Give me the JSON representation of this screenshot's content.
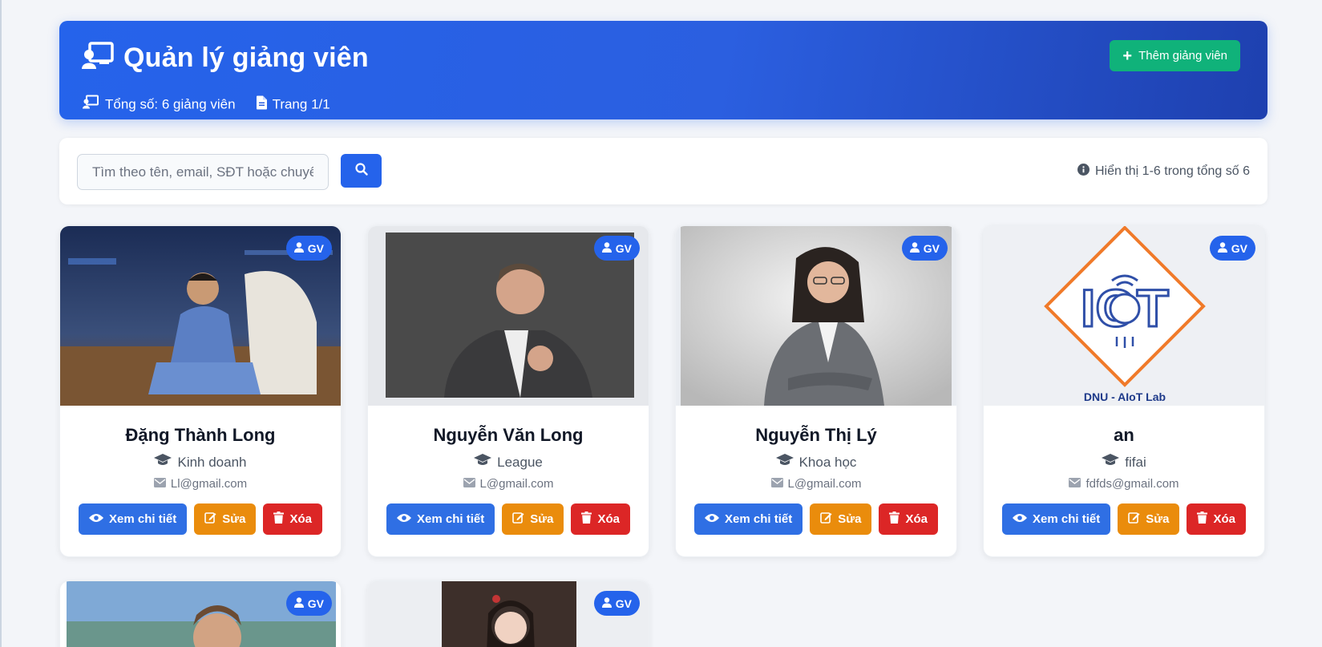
{
  "header": {
    "title": "Quản lý giảng viên",
    "total_label": "Tổng số: 6 giảng viên",
    "page_label": "Trang 1/1",
    "add_button_label": "Thêm giảng viên"
  },
  "search": {
    "placeholder": "Tìm theo tên, email, SĐT hoặc chuyên môn",
    "info": "Hiển thị 1-6 trong tổng số 6"
  },
  "colors": {
    "primary": "#2563eb",
    "success": "#10b27a",
    "warning": "#ea8c0c",
    "danger": "#dc2626"
  },
  "card_actions": {
    "view_label": "Xem chi tiết",
    "edit_label": "Sửa",
    "delete_label": "Xóa"
  },
  "lecturers": [
    {
      "badge": "GV",
      "name": "Đặng Thành Long",
      "department": "Kinh doanh",
      "email": "Ll@gmail.com"
    },
    {
      "badge": "GV",
      "name": "Nguyễn Văn Long",
      "department": "League",
      "email": "L@gmail.com"
    },
    {
      "badge": "GV",
      "name": "Nguyễn Thị Lý",
      "department": "Khoa học",
      "email": "L@gmail.com"
    },
    {
      "badge": "GV",
      "name": "an",
      "department": "fifai",
      "email": "fdfds@gmail.com",
      "logo_text": "DNU - AIoT Lab"
    },
    {
      "badge": "GV"
    },
    {
      "badge": "GV"
    }
  ]
}
